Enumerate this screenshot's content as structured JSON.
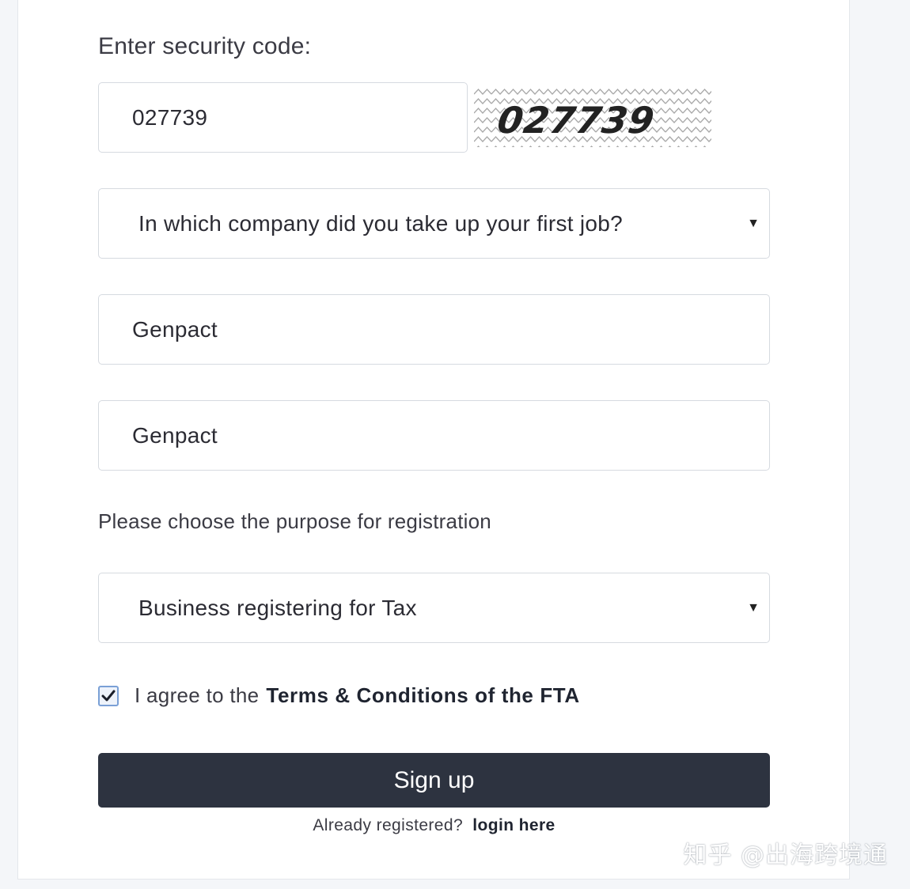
{
  "form": {
    "security_label": "Enter security code:",
    "security_value": "027739",
    "captcha_text": "027739",
    "question_select": "In which company did you take up your first job?",
    "answer_value": "Genpact",
    "answer_confirm_value": "Genpact",
    "purpose_label": "Please choose the purpose for registration",
    "purpose_select": "Business registering for Tax",
    "agree_checked": true,
    "agree_text": "I agree to the",
    "agree_link": "Terms & Conditions of the FTA",
    "signup_label": "Sign up",
    "already_text": "Already registered?",
    "login_link": "login here"
  },
  "watermark": "知乎 @出海跨境通",
  "icons": {
    "caret": "caret-down-icon",
    "check": "checkmark-icon"
  }
}
